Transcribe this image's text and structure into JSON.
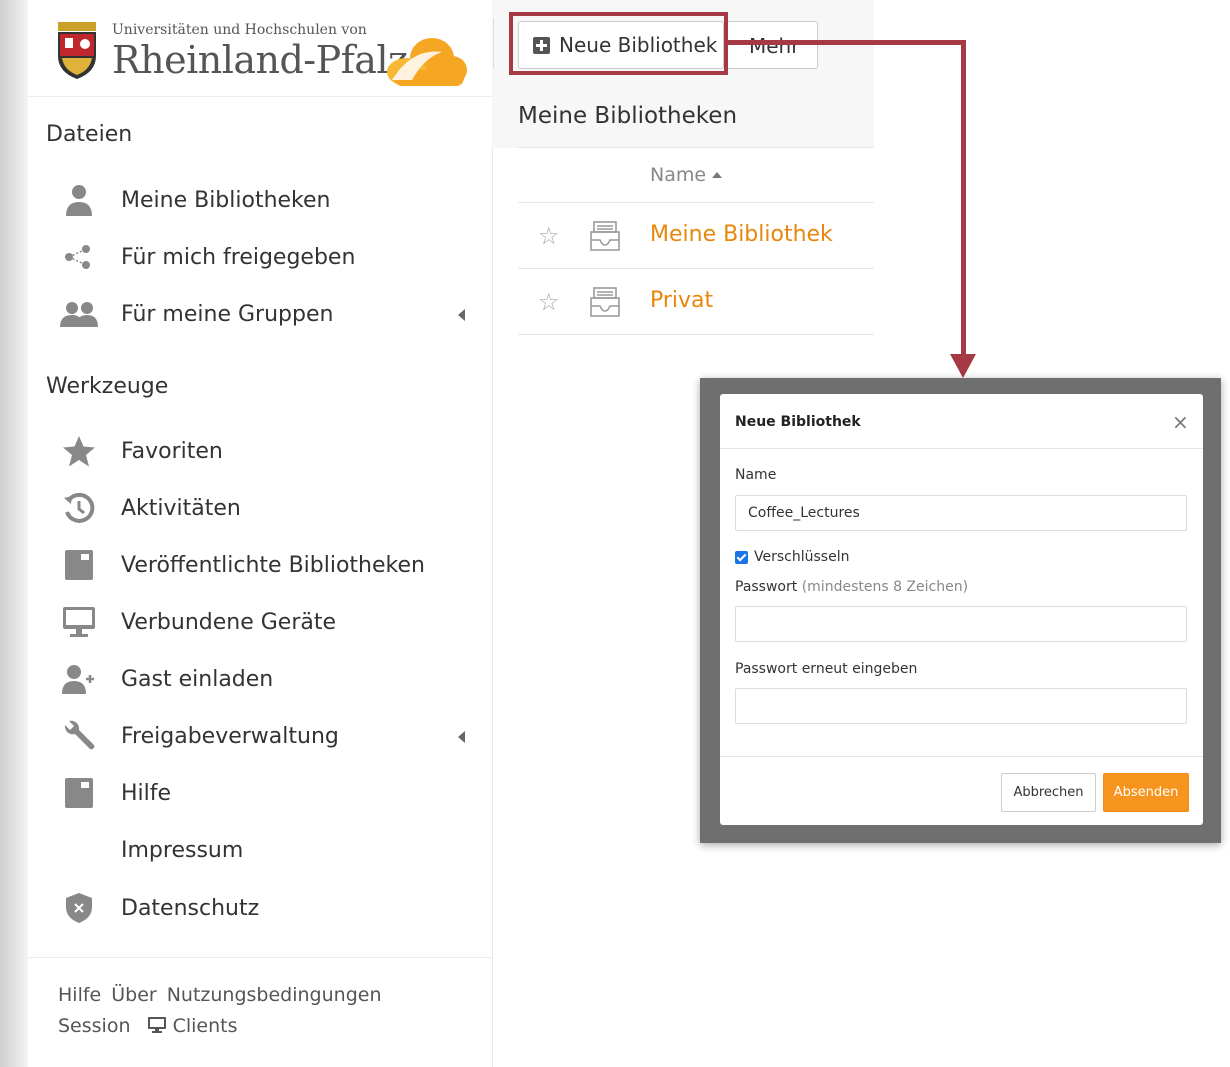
{
  "logo": {
    "small_text": "Universitäten und Hochschulen von",
    "big_text": "Rheinland-Pfalz"
  },
  "sidebar": {
    "section_files": "Dateien",
    "files_items": [
      {
        "label": "Meine Bibliotheken",
        "icon": "user-icon"
      },
      {
        "label": "Für mich freigegeben",
        "icon": "share-icon"
      },
      {
        "label": "Für meine Gruppen",
        "icon": "group-icon"
      }
    ],
    "section_tools": "Werkzeuge",
    "tools_items": [
      {
        "label": "Favoriten",
        "icon": "star-icon"
      },
      {
        "label": "Aktivitäten",
        "icon": "history-icon"
      },
      {
        "label": "Veröffentlichte Bibliotheken",
        "icon": "book-icon"
      },
      {
        "label": "Verbundene Geräte",
        "icon": "monitor-icon"
      },
      {
        "label": "Gast einladen",
        "icon": "user-plus-icon"
      },
      {
        "label": "Freigabeverwaltung",
        "icon": "wrench-icon"
      },
      {
        "label": "Hilfe",
        "icon": "book-icon"
      },
      {
        "label": "Impressum",
        "icon": ""
      },
      {
        "label": "Datenschutz",
        "icon": "shield-icon"
      }
    ],
    "footer": {
      "help": "Hilfe",
      "about": "Über",
      "terms": "Nutzungsbedingungen",
      "session": "Session",
      "clients": "Clients"
    }
  },
  "toolbar": {
    "new_library": "Neue Bibliothek",
    "more": "Mehr"
  },
  "main": {
    "heading": "Meine Bibliotheken",
    "column_name": "Name",
    "libraries": [
      "Meine Bibliothek",
      "Privat"
    ]
  },
  "modal": {
    "title": "Neue Bibliothek",
    "close": "×",
    "name_label": "Name",
    "name_value": "Coffee_Lectures",
    "encrypt_label": "Verschlüsseln",
    "encrypt_checked": true,
    "password_label": "Passwort",
    "password_hint": "(mindestens 8 Zeichen)",
    "password_repeat_label": "Passwort erneut eingeben",
    "cancel": "Abbrechen",
    "submit": "Absenden"
  },
  "colors": {
    "accent": "#f7941d",
    "link": "#e8870b",
    "annotation": "#a63a44"
  }
}
